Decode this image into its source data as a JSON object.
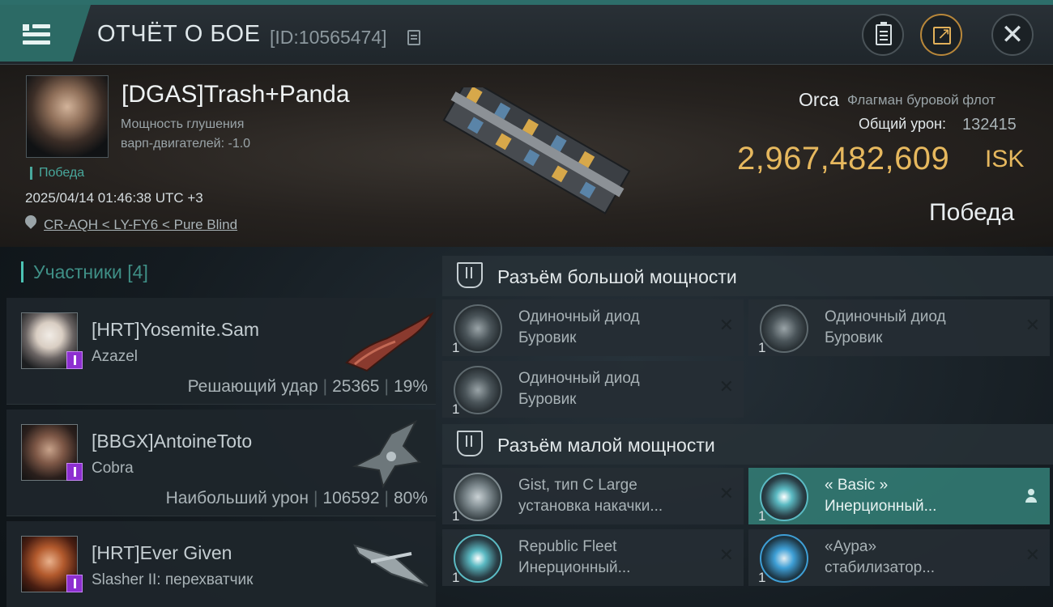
{
  "header": {
    "title": "ОТЧЁТ О БОЕ",
    "battle_id": "[ID:10565474]"
  },
  "victim": {
    "name": "[DGAS]Trash+Panda",
    "stat_line1": "Мощность глушения",
    "stat_line2": "варп-двигателей: -1.0",
    "status": "Победа",
    "datetime": "2025/04/14 01:46:38 UTC +3",
    "location": "CR-AQH < LY-FY6 < Pure Blind",
    "ship_name": "Orca",
    "ship_class": "Флагман буровой флот",
    "damage_label": "Общий урон:",
    "damage_value": "132415",
    "isk_value": "2,967,482,609",
    "isk_unit": "ISK",
    "result": "Победа"
  },
  "participants": {
    "header": "Участники [4]",
    "items": [
      {
        "name": "[HRT]Yosemite.Sam",
        "ship": "Azazel",
        "role": "Решающий удар",
        "damage": "25365",
        "percent": "19%"
      },
      {
        "name": "[BBGX]AntoineToto",
        "ship": "Cobra",
        "role": "Наибольший урон",
        "damage": "106592",
        "percent": "80%"
      },
      {
        "name": "[HRT]Ever Given",
        "ship": "Slasher II: перехватчик"
      }
    ]
  },
  "slots": {
    "high": {
      "title": "Разъём большой мощности",
      "modules": [
        {
          "qty": "1",
          "line1": "Одиночный диод",
          "line2": "Буровик"
        },
        {
          "qty": "1",
          "line1": "Одиночный диод",
          "line2": "Буровик"
        },
        {
          "qty": "1",
          "line1": "Одиночный диод",
          "line2": "Буровик"
        }
      ]
    },
    "low": {
      "title": "Разъём малой мощности",
      "modules": [
        {
          "qty": "1",
          "line1": "Gist, тип C Large",
          "line2": "установка накачки..."
        },
        {
          "qty": "1",
          "line1": "« Basic »",
          "line2": "Инерционный..."
        },
        {
          "qty": "1",
          "line1": "Republic Fleet",
          "line2": "Инерционный..."
        },
        {
          "qty": "1",
          "line1": "«Аура»",
          "line2": "стабилизатор..."
        }
      ]
    }
  },
  "colors": {
    "accent_teal": "#2c6a65",
    "isk_gold": "#e6b85e",
    "victory_green": "#48a89c",
    "role_purple": "#8d2fd0"
  }
}
